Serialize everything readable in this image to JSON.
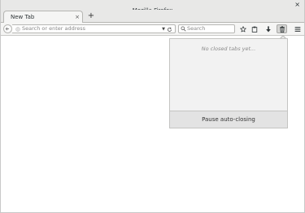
{
  "window": {
    "title": "Mozilla Firefox",
    "close_glyph": "×"
  },
  "tabs": [
    {
      "label": "New Tab",
      "close_glyph": "×",
      "active": true
    }
  ],
  "new_tab_glyph": "+",
  "navbar": {
    "url_placeholder": "Search or enter address",
    "search_placeholder": "Search"
  },
  "toolbar": {
    "buttons": [
      {
        "icon": "star-icon"
      },
      {
        "icon": "clipboard-icon"
      },
      {
        "icon": "download-icon"
      },
      {
        "icon": "trash-icon",
        "active": true
      },
      {
        "icon": "menu-icon"
      }
    ]
  },
  "closed_tabs_panel": {
    "empty_message": "No closed tabs yet...",
    "footer_button": "Pause auto-closing"
  }
}
